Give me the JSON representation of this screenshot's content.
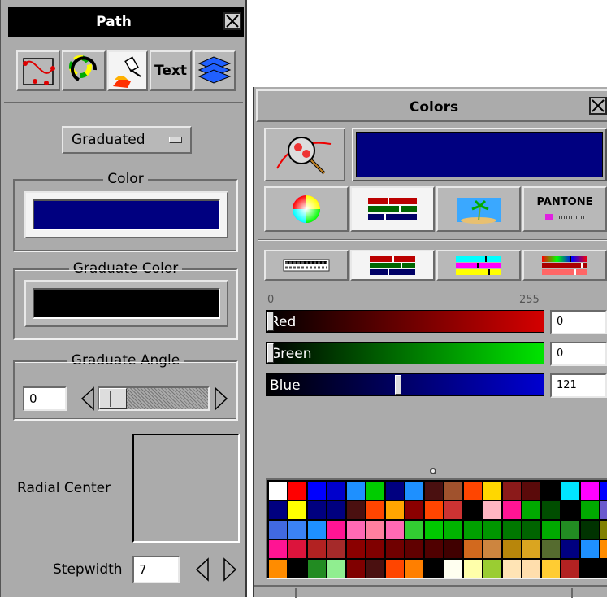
{
  "path_panel": {
    "title": "Path",
    "toolbar": {
      "text_tool_label": "Text"
    },
    "fill_type": "Graduated",
    "color_group": {
      "label": "Color",
      "value": "#000080"
    },
    "graduate_color_group": {
      "label": "Graduate Color",
      "value": "#000000"
    },
    "graduate_angle_group": {
      "label": "Graduate Angle",
      "value": "0"
    },
    "radial_center_label": "Radial Center",
    "stepwidth": {
      "label": "Stepwidth",
      "value": "7"
    }
  },
  "colors_panel": {
    "title": "Colors",
    "current_color": "#000080",
    "mode_tabs": {
      "pantone_label": "PANTONE"
    },
    "scale": {
      "min": "0",
      "max": "255"
    },
    "sliders": [
      {
        "name": "Red",
        "value": "0",
        "fraction": 0,
        "color_from": "#000000",
        "color_to": "#d40000"
      },
      {
        "name": "Green",
        "value": "0",
        "fraction": 0,
        "color_from": "#000000",
        "color_to": "#00e400"
      },
      {
        "name": "Blue",
        "value": "121",
        "fraction": 0.475,
        "color_from": "#000000",
        "color_to": "#0000d0"
      }
    ],
    "palette": [
      "#ffffff",
      "#ff0000",
      "#0000ff",
      "#0000cc",
      "#1e90ff",
      "#00cc00",
      "#000080",
      "#1e90ff",
      "#4a1010",
      "#a0522d",
      "#ff4500",
      "#ffd700",
      "#8b1a1a",
      "#5a0a0a",
      "#000000",
      "#00e5ff",
      "#ff00ff",
      "#0000ff",
      "#000080",
      "#ffff00",
      "#000080",
      "#000080",
      "#4a1010",
      "#ff4500",
      "#ffa500",
      "#8b0000",
      "#ff4500",
      "#cd3333",
      "#000000",
      "#ffb6c1",
      "#ff1493",
      "#00aa00",
      "#004d00",
      "#000000",
      "#00aa00",
      "#6a5acd",
      "#4169e1",
      "#3b82f6",
      "#1e90ff",
      "#ff1493",
      "#ff69b4",
      "#ff7f9f",
      "#ff69b4",
      "#32cd32",
      "#00c800",
      "#00b400",
      "#00a000",
      "#009600",
      "#007800",
      "#006400",
      "#00aa00",
      "#228b22",
      "#003300",
      "#808000",
      "#ff1493",
      "#dc143c",
      "#b22222",
      "#a52a2a",
      "#8b0000",
      "#800000",
      "#700000",
      "#600000",
      "#500000",
      "#400000",
      "#d2691e",
      "#cd853f",
      "#b8860b",
      "#daa520",
      "#556b2f",
      "#000080",
      "#1e90ff",
      "#ff8c00",
      "#ff8c00",
      "#000000",
      "#228b22",
      "#90ee90",
      "#800000",
      "#4a1010",
      "#ff4500",
      "#ff7f00",
      "#000000",
      "#fffff0",
      "#ffffaa",
      "#9acd32",
      "#ffe4b5",
      "#ffdead",
      "#ffcc33",
      "#b22222"
    ]
  }
}
